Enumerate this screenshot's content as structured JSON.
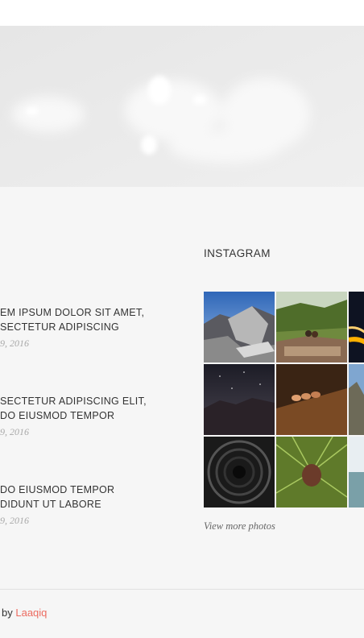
{
  "hero": {
    "image": "blurred-white-texture"
  },
  "posts": [
    {
      "title": "EM IPSUM DOLOR SIT AMET,\nSECTETUR ADIPISCING",
      "date": "9, 2016"
    },
    {
      "title": "SECTETUR ADIPISCING ELIT,\nDO EIUSMOD TEMPOR",
      "date": "9, 2016"
    },
    {
      "title": "DO EIUSMOD TEMPOR\nDIDUNT UT LABORE",
      "date": "9, 2016"
    }
  ],
  "instagram": {
    "title": "INSTAGRAM",
    "photos": [
      "mountain-granite-dome",
      "couple-on-cliff",
      "night-light-trails",
      "starry-mountain-night",
      "wooden-figures-closeup",
      "rocky-peak",
      "tunnel-interior",
      "pine-cone-branch",
      "sea-horizon"
    ],
    "more_label": "View more photos"
  },
  "footer": {
    "credit_prefix": "by",
    "credit_link": "Laaqiq",
    "accent": "#ec6b60"
  }
}
